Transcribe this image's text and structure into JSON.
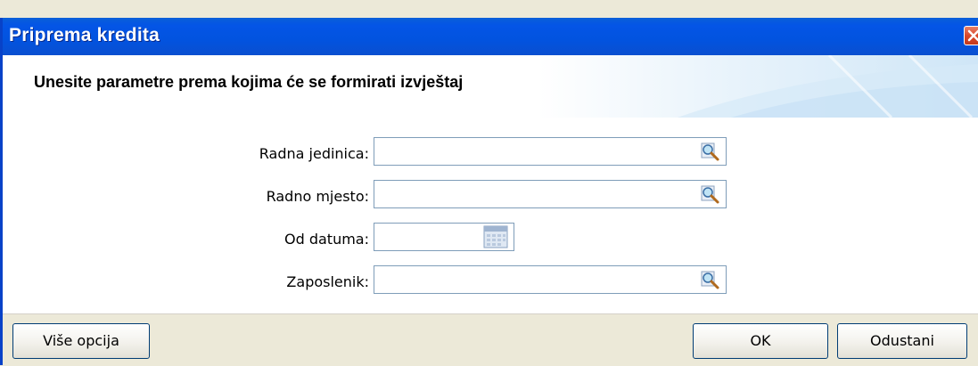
{
  "window": {
    "title": "Priprema kredita"
  },
  "header": {
    "heading": "Unesite parametre prema kojima će se formirati izvještaj"
  },
  "form": {
    "fields": [
      {
        "label": "Radna jedinica:",
        "value": ""
      },
      {
        "label": "Radno mjesto:",
        "value": ""
      },
      {
        "label": "Od datuma:",
        "value": ""
      },
      {
        "label": "Zaposlenik:",
        "value": ""
      }
    ]
  },
  "buttons": {
    "more_options": "Više opcija",
    "ok": "OK",
    "cancel": "Odustani"
  },
  "colors": {
    "titlebar": "#0455e6",
    "window_bg": "#ece9d8",
    "close": "#d9482b"
  },
  "icons": {
    "lookup": "search-lookup-icon",
    "calendar": "calendar-icon",
    "close": "close-icon"
  }
}
